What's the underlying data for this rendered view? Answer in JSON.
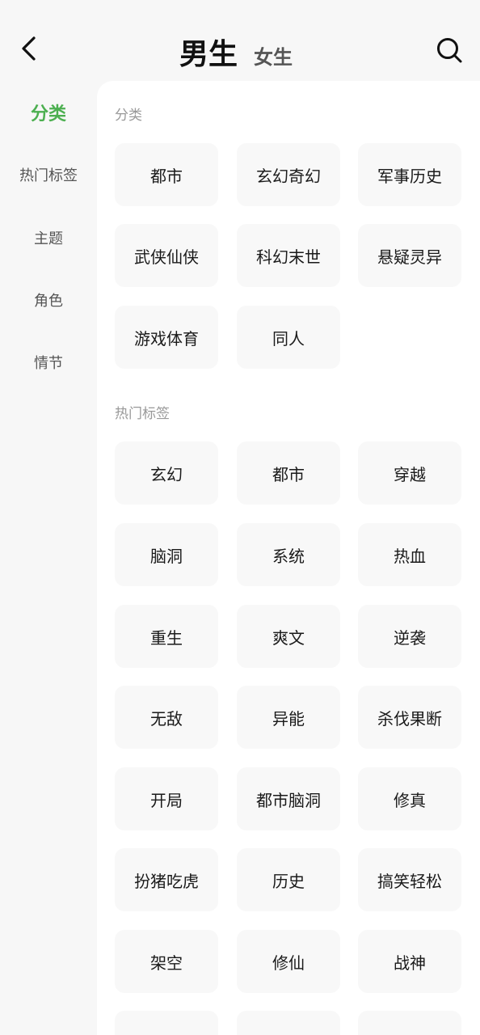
{
  "header": {
    "tab_male": "男生",
    "tab_female": "女生",
    "back_icon": "chevron-left-icon",
    "search_icon": "search-icon"
  },
  "sidebar": {
    "items": [
      "分类",
      "热门标签",
      "主题",
      "角色",
      "情节"
    ],
    "active": 0,
    "active_color": "#4caf50"
  },
  "sections": [
    {
      "title": "分类",
      "tags": [
        "都市",
        "玄幻奇幻",
        "军事历史",
        "武侠仙侠",
        "科幻末世",
        "悬疑灵异",
        "游戏体育",
        "同人"
      ]
    },
    {
      "title": "热门标签",
      "tags": [
        "玄幻",
        "都市",
        "穿越",
        "脑洞",
        "系统",
        "热血",
        "重生",
        "爽文",
        "逆袭",
        "无敌",
        "异能",
        "杀伐果断",
        "开局",
        "都市脑洞",
        "修真",
        "扮猪吃虎",
        "历史",
        "搞笑轻松",
        "架空",
        "修仙",
        "战神"
      ]
    }
  ]
}
